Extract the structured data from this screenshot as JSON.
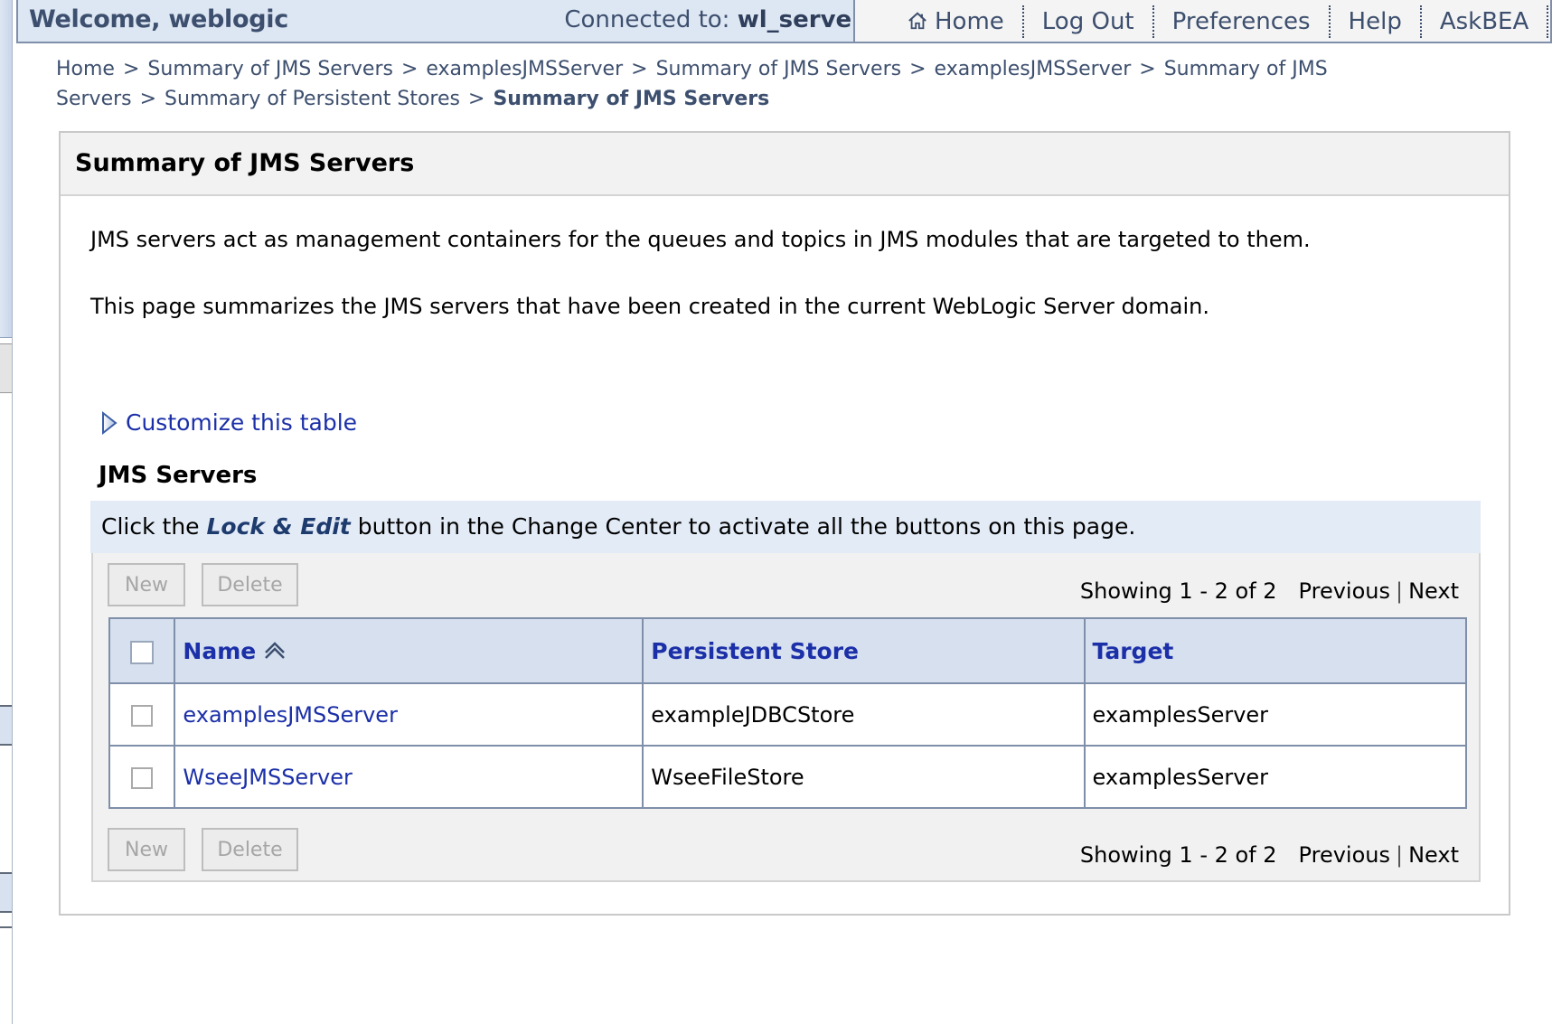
{
  "header": {
    "welcome": "Welcome, weblogic",
    "connected_label": "Connected to:",
    "server": "wl_server",
    "nav": [
      {
        "label": "Home",
        "icon": "home-icon"
      },
      {
        "label": "Log Out"
      },
      {
        "label": "Preferences"
      },
      {
        "label": "Help"
      },
      {
        "label": "AskBEA"
      }
    ]
  },
  "breadcrumb": [
    "Home",
    "Summary of JMS Servers",
    "examplesJMSServer",
    "Summary of JMS Servers",
    "examplesJMSServer",
    "Summary of JMS Servers",
    "Summary of Persistent Stores",
    "Summary of JMS Servers"
  ],
  "breadcrumb_separator": ">",
  "panel": {
    "title": "Summary of JMS Servers",
    "description_1": "JMS servers act as management containers for the queues and topics in JMS modules that are targeted to them.",
    "description_2": "This page summarizes the JMS servers that have been created in the current WebLogic Server domain.",
    "customize_link": "Customize this table",
    "table_caption": "JMS Servers",
    "info_prefix": "Click the ",
    "info_emphasis": "Lock & Edit",
    "info_suffix": " button in the Change Center to activate all the buttons on this page."
  },
  "buttons": {
    "new": "New",
    "delete": "Delete"
  },
  "pager": {
    "showing": "Showing 1 - 2 of 2",
    "previous": "Previous",
    "separator": "|",
    "next": "Next"
  },
  "table": {
    "columns": [
      "Name",
      "Persistent Store",
      "Target"
    ],
    "rows": [
      {
        "name": "examplesJMSServer",
        "store": "exampleJDBCStore",
        "target": "examplesServer"
      },
      {
        "name": "WseeJMSServer",
        "store": "WseeFileStore",
        "target": "examplesServer"
      }
    ]
  },
  "colors": {
    "link": "#1b2fa8",
    "header_text": "#3d4f6e",
    "header_bg": "#dde6f3",
    "table_header_bg": "#d6e0ef",
    "info_bar_bg": "#e3ebf7"
  }
}
